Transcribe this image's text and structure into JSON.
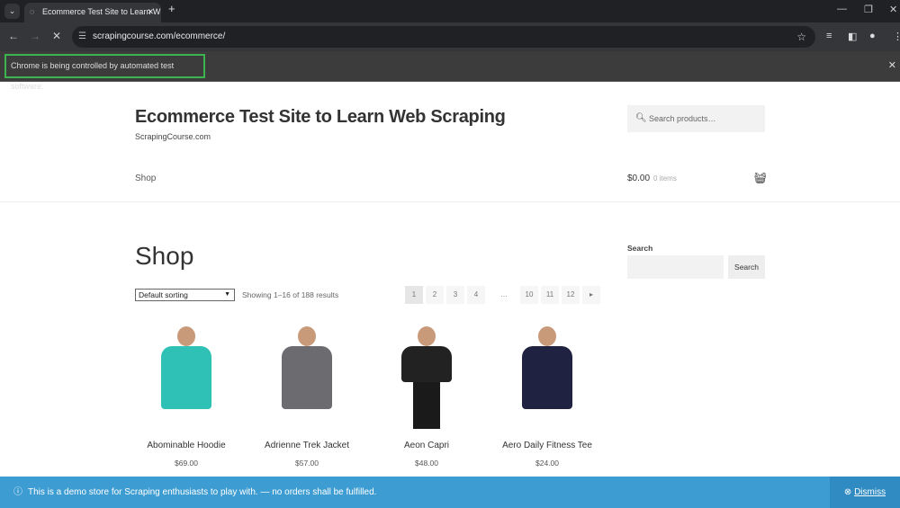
{
  "browser": {
    "tab_title": "Ecommerce Test Site to Learn W",
    "url": "scrapingcourse.com/ecommerce/",
    "infobar": "Chrome is being controlled by automated test software."
  },
  "site": {
    "title": "Ecommerce Test Site to Learn Web Scraping",
    "tagline": "ScrapingCourse.com",
    "search_placeholder": "Search products…",
    "nav_shop": "Shop",
    "cart_total": "$0.00",
    "cart_items": "0 items"
  },
  "main": {
    "heading": "Shop",
    "sorting": "Default sorting",
    "result_count": "Showing 1–16 of 188 results",
    "pages": [
      "1",
      "2",
      "3",
      "4",
      "…",
      "10",
      "11",
      "12"
    ],
    "current_page": "1",
    "products": [
      {
        "name": "Abominable Hoodie",
        "price": "$69.00",
        "color": "#2fc1b5"
      },
      {
        "name": "Adrienne Trek Jacket",
        "price": "$57.00",
        "color": "#6b6b70"
      },
      {
        "name": "Aeon Capri",
        "price": "$48.00",
        "color": "#1a1a1a"
      },
      {
        "name": "Aero Daily Fitness Tee",
        "price": "$24.00",
        "color": "#1f2240"
      }
    ]
  },
  "sidebar": {
    "label": "Search",
    "button": "Search"
  },
  "notice": {
    "text": "This is a demo store for Scraping enthusiasts to play with. — no orders shall be fulfilled.",
    "dismiss": "Dismiss",
    "color": "#3d9cd2"
  }
}
